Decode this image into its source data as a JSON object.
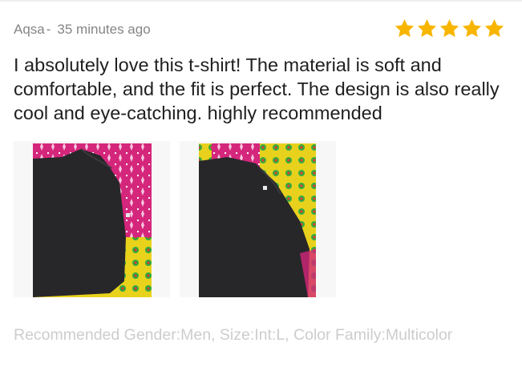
{
  "review": {
    "author": "Aqsa",
    "separator": "-",
    "time_ago": "35  minutes ago",
    "rating": 5,
    "rating_max": 5,
    "star_color": "#f7b500",
    "text": "I absolutely love this t-shirt! The material is soft and comfortable, and the fit is perfect. The design is also really cool and eye-catching. highly recommended",
    "photos": [
      {
        "icon": "photo-black-tshirt-1"
      },
      {
        "icon": "photo-black-tshirt-2"
      }
    ],
    "attributes": "Recommended Gender:Men, Size:Int:L, Color Family:Multicolor"
  }
}
